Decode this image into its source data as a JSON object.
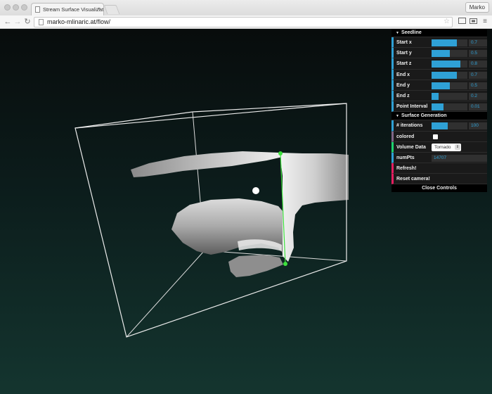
{
  "browser": {
    "tab_title": "Stream Surface Visualizati...",
    "tab_close": "×",
    "user_name": "Marko",
    "url": "marko-mlinaric.at/flow/",
    "nav": {
      "back": "←",
      "forward": "→",
      "reload": "↻"
    },
    "star": "☆",
    "menu": "≡"
  },
  "gui": {
    "seedline": {
      "title": "Seedline",
      "controls": [
        {
          "label": "Start x",
          "value": "0.7",
          "fraction": 0.7
        },
        {
          "label": "Start y",
          "value": "0.5",
          "fraction": 0.5
        },
        {
          "label": "Start z",
          "value": "0.8",
          "fraction": 0.8
        },
        {
          "label": "End x",
          "value": "0.7",
          "fraction": 0.7
        },
        {
          "label": "End y",
          "value": "0.5",
          "fraction": 0.5
        },
        {
          "label": "End z",
          "value": "0.2",
          "fraction": 0.2
        },
        {
          "label": "Point Interval",
          "value": "0.01",
          "fraction": 0.33
        }
      ]
    },
    "surface": {
      "title": "Surface Generation",
      "iterations_label": "# iterations",
      "iterations_value": "100",
      "iterations_fraction": 0.45,
      "colored_label": "colored",
      "volume_label": "Volume Data",
      "volume_value": "Tornado",
      "numpts_label": "numPts",
      "numpts_value": "14707"
    },
    "refresh_label": "Refresh!",
    "reset_label": "Reset camera!",
    "close_label": "Close Controls"
  },
  "colors": {
    "slider_fill": "#2fa1d6",
    "seedline": "#3ee23e"
  }
}
